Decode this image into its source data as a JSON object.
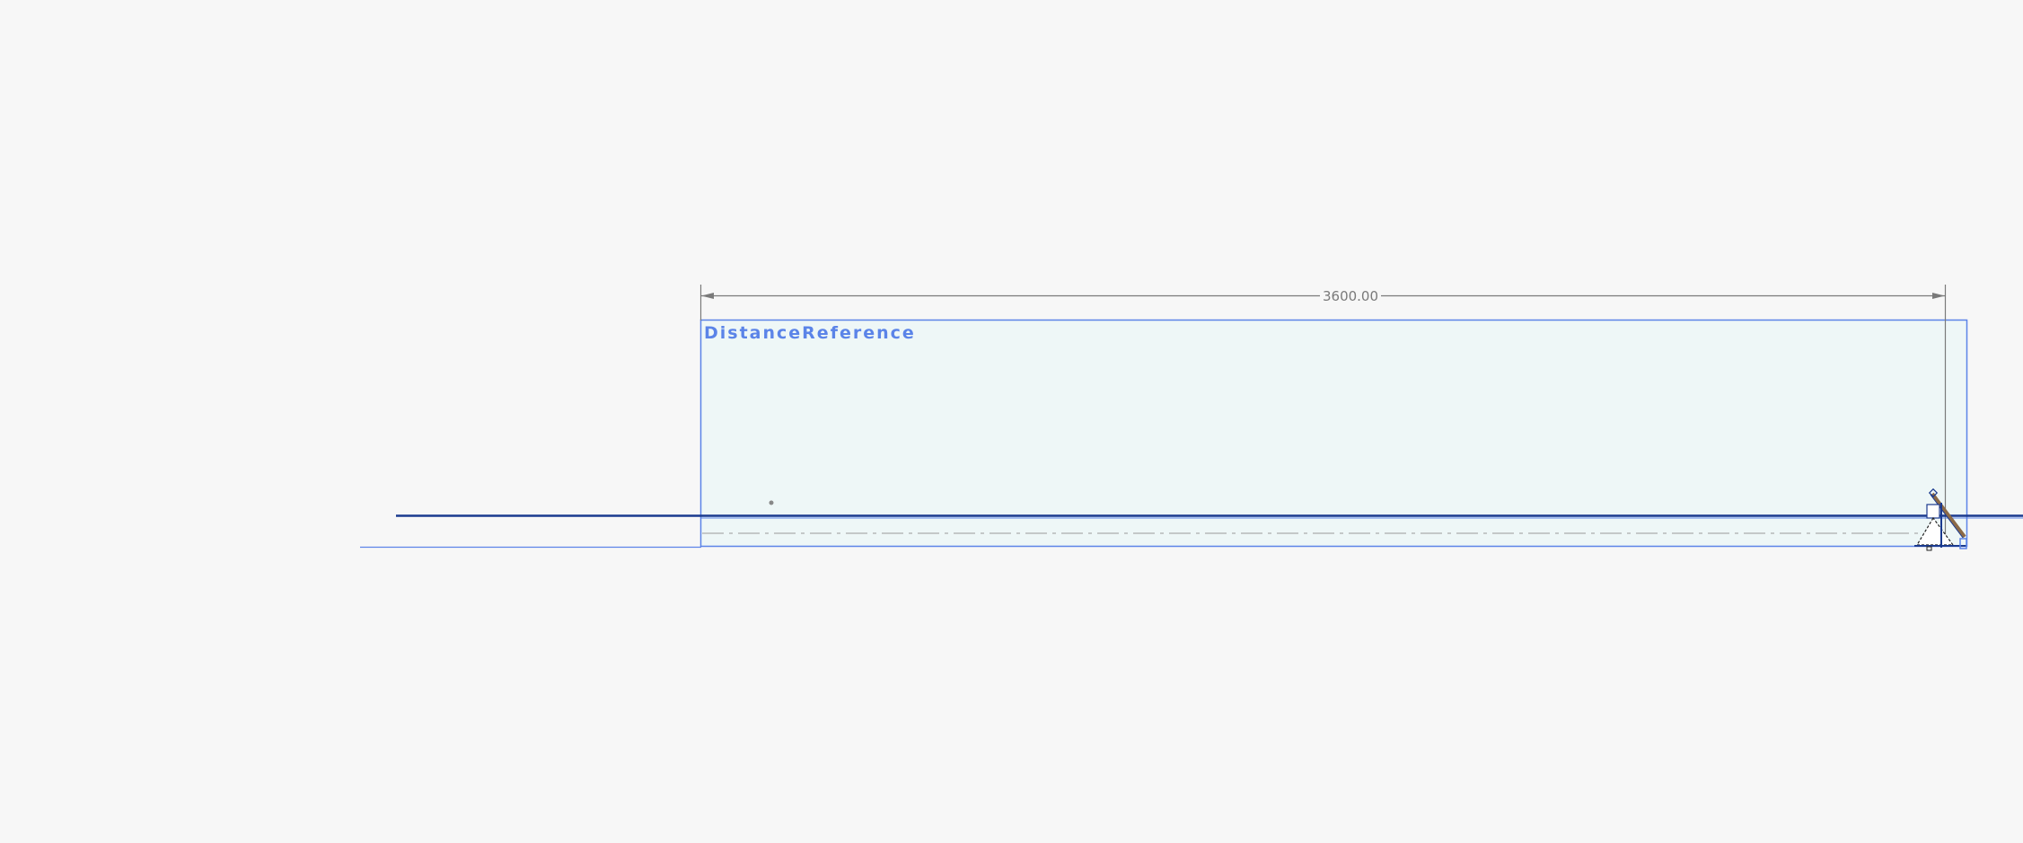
{
  "drawing": {
    "dimension_value": "3600.00",
    "reference_label": "DistanceReference",
    "colors": {
      "background": "#f7f7f7",
      "region_fill": "#eef7f7",
      "region_border": "#5b84e8",
      "ground_line": "#1a3a8f",
      "dimension": "#7a7a7a"
    },
    "icons": [
      "derrick-crane-icon"
    ]
  }
}
